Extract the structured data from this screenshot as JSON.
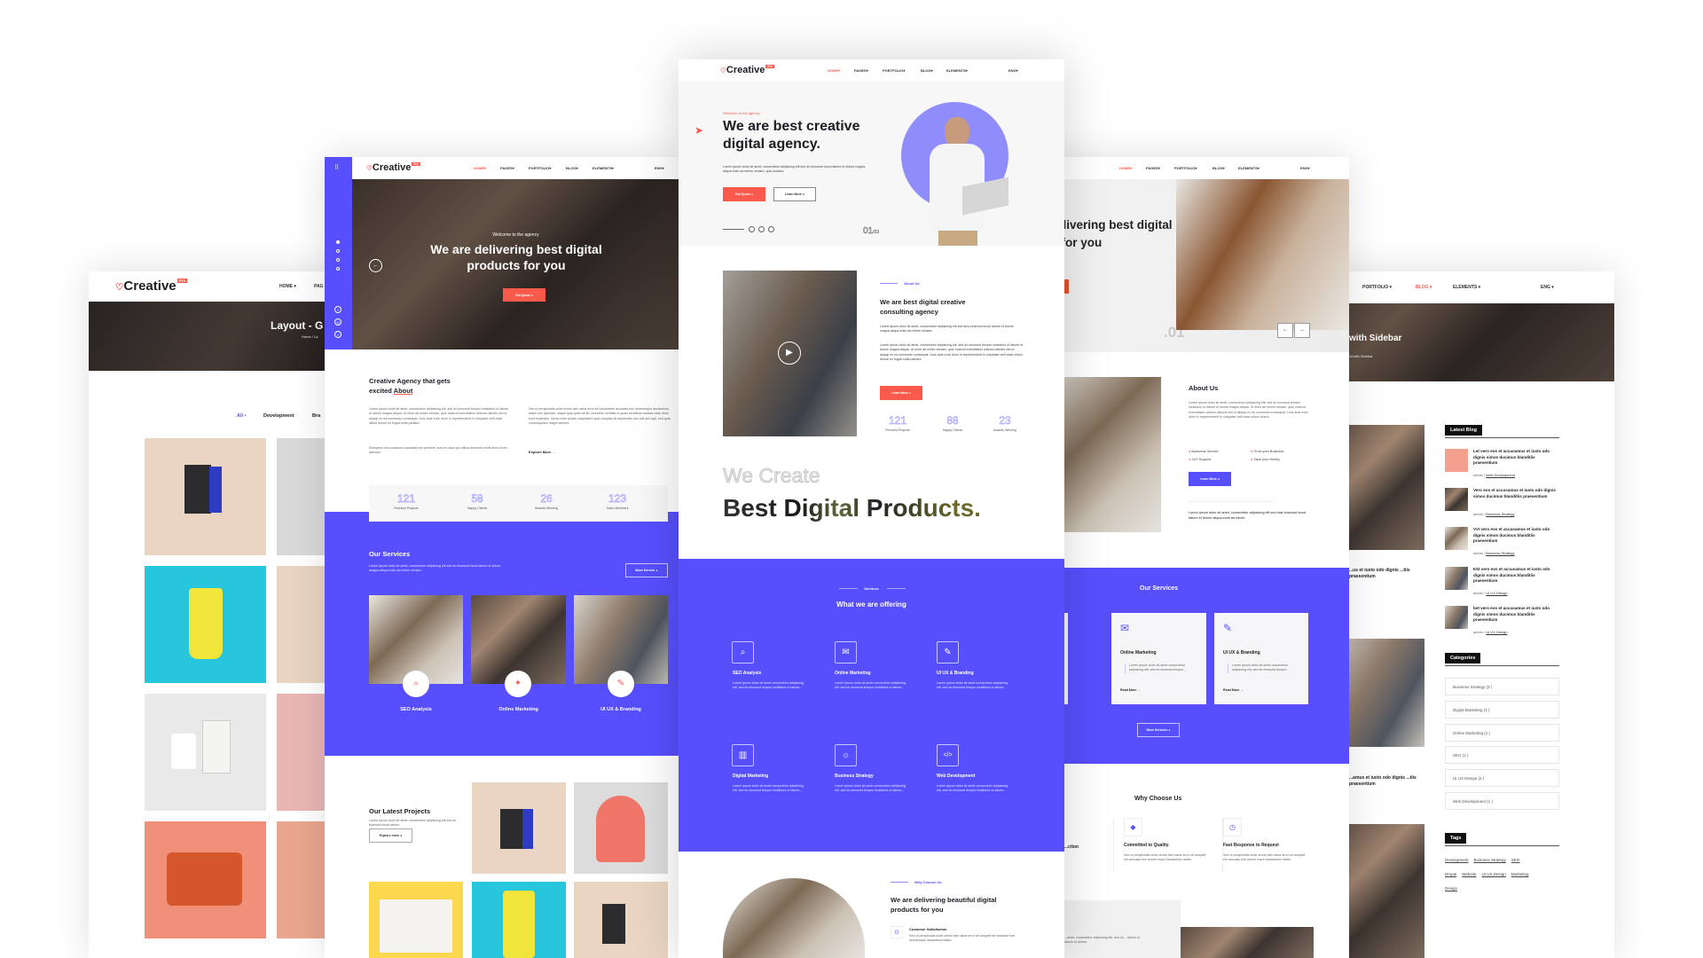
{
  "brand": {
    "logo": "Creative",
    "badge": "Pro",
    "accent": "#574ffe",
    "red": "#fa5a4c"
  },
  "nav": {
    "home": "HOME",
    "pages": "PAGES",
    "portfolio": "PORTFOLIO",
    "blog": "BLOG",
    "elements": "ELEMENTS",
    "eng": "ENG",
    "pag": "PAG"
  },
  "grid_page": {
    "hero_title": "Layout - G",
    "breadcrumb": "Home / La",
    "filters": [
      "All",
      "Development",
      "Bra"
    ]
  },
  "agency_page": {
    "hero_kicker": "Welcome to the agency",
    "hero_title": "We are delivering best digital products for you",
    "hero_btn": "Get Quote",
    "about_title_1": "Creative Agency that gets",
    "about_title_2": "excited",
    "about_title_3": "About",
    "about_p1": "Lorem ipsum dolor sit amet, consectetur adipiscing elit, sed do eiusmod tempor incididunt ut labore et dolore magna aliqua. Ut enim ad minim veniam, quis nostrud exercitation ullamco laboris nisi ut aliquip ex ea commodo consequat. Duis aute irure dolor in reprehenderit in voluptate velit esse cillum dolore eu fugiat nulla pariatur.",
    "about_p2": "Excepteur sint occaecat cupidatat non proident, sunt in culpa qui officia deserunt mollit anim id est laborum.",
    "about_p3": "Sed ut perspiciatis unde omnis iste natus error sit voluptatem accusant ium doloremque laudantium, totam rem aperiam, eaque ipsa quae ab illo inventore veritatis et quasi architecto beatae vitae dicta sunt explicabo. Nemo enim ipsam voluptatem quia voluptas sit aspernatur aut odit aut fugit, sed quia consequuntur magni dolores.",
    "explore": "Explore More →",
    "stats": [
      {
        "n": "121",
        "l": "Finished Projects"
      },
      {
        "n": "58",
        "l": "Happy Clients"
      },
      {
        "n": "26",
        "l": "Awards Winning"
      },
      {
        "n": "123",
        "l": "Team Members"
      }
    ],
    "services_title": "Our Services",
    "services_p": "Lorem ipsum dolor sit amet, consectetur adipiscing elit sed do eiusmod incod labore et dolore magna aliqua enim ad minim veniam.",
    "more_service": "More Service",
    "services": [
      "SEO Analysis",
      "Online Marketing",
      "UI UX & Branding"
    ],
    "projects_title": "Our Latest Projects",
    "projects_p": "Lorem ipsum dolor sit amet, consectetur adipiscing elit sed do eiusmod incod labore.",
    "projects_btn": "Explore more"
  },
  "home_page": {
    "kicker": "Welcome to the agency",
    "title_1": "We are best creative",
    "title_2": "digital agency.",
    "para": "Lorem ipsum dolor sit amet, consectetur adipiscing elit sed do eiusmod incod labore et dolore magna aliqua enim ad minim veniam, quis nostrud.",
    "get_quote": "Get Quote",
    "learn_more": "Learn More",
    "slide_current": "01",
    "slide_total": "/03",
    "about_label": "About Us",
    "about_title": "We are best digital creative consulting agency",
    "about_p1": "Lorem ipsum dolor sit amet, consectetur adipiscing elit sed duis eiusmod incod labore et dolore magna aliqua enim ad minim veniam.",
    "about_p2": "Lorem ipsum dolor sit amet, consectetur adipiscing elit, sed do eiusmod tempor incididunt ut labore et dolore magna aliqua. Ut enim ad minim veniam, quis nostrud exercitation ullamco laboris nisi ut aliquip ex ea commodo consequat. Duis aute irure dolor in reprehenderit in voluptate velit esse cillum dolore eu fugiat nulla pariatur.",
    "about_btn": "Learn More",
    "stats": [
      {
        "n": "121",
        "l": "Finished Projects"
      },
      {
        "n": "88",
        "l": "Happy Clients"
      },
      {
        "n": "23",
        "l": "Awards Winning"
      }
    ],
    "we_create": "We Create",
    "best_digital": "Best Digital Products.",
    "services_label": "Services",
    "services_title": "What we are offering",
    "service_desc": "Lorem ipsum dolor sit amet consectetur adipiscing elit, sed do eiusmod tempor incididunt ut labore...",
    "services": [
      {
        "t": "SEO Analysis",
        "icon": "search-chart-icon"
      },
      {
        "t": "Online Marketing",
        "icon": "megaphone-icon"
      },
      {
        "t": "UI UX & Branding",
        "icon": "pen-tool-icon"
      },
      {
        "t": "Digital Marketing",
        "icon": "bar-chart-icon"
      },
      {
        "t": "Business Strategy",
        "icon": "lightbulb-icon"
      },
      {
        "t": "Web Development",
        "icon": "code-window-icon"
      }
    ],
    "why_label": "Why Choose Us",
    "why_title": "We are delivering beautiful digital products for you",
    "why_item_title": "Customer Satisfaction",
    "why_item_text": "Sed ut perspiciatis unde omnis iste natus error sit voluptat em accusan ium doloremque laudantium totam."
  },
  "business_page": {
    "hero_title": "We are delivering best digital products for you",
    "slide": ".01",
    "about_title": "About Us",
    "about_p": "Lorem ipsum dolor sit amet, consectetur adipiscing elit, sed do eiusmod tempor incididunt ut labore et dolore magna aliqua. Ut enim ad minim veniam, quis nostrud exercitation ullamco laboris nisi ut aliquip ex ea commodo consequat. Duis aute irure dolor in reprehenderit in voluptate velit esse cillum dolore.",
    "checks": [
      "Awesome Service",
      "Grow your Business",
      "24/7 Support",
      "Save your Money"
    ],
    "about_btn": "Learn More",
    "about_p2": "Lorem ipsum dolor sit amet, consectetur adipiscing elit sed duis eiusmod incod labore et dolore aliqua enim ad minim.",
    "services_title": "Our Services",
    "cards": [
      {
        "t": "Online Marketing",
        "d": "Lorem ipsum dolor sit amet consectetur adipiscing elit, sed do eiusmod tempor..."
      },
      {
        "t": "UI UX & Branding",
        "d": "Lorem ipsum dolor sit amet consectetur adipiscing elit, sed do eiusmod tempor..."
      }
    ],
    "card_partial": "...amet ...elit, sed do",
    "read_more": "Read More →",
    "more_services": "More Services",
    "why_title": "Why Choose Us",
    "why": [
      {
        "t": "Committed to Quality",
        "d": "Sed ut perspiciatis unde omnis iste natus error sit voluptat em accusan ium dolore mque laudantium totam."
      },
      {
        "t": "Fast Response to Request",
        "d": "Sed ut perspiciatis unde omnis iste natus error sit voluptat em accusan ium dolore mque laudantium totam."
      }
    ],
    "why_partial": "...ction",
    "bottom_p": "...amet, consectetur adipiscing elit, sed do ...didunt ut labore et dolore."
  },
  "blog_page": {
    "hero_title": "with Sidebar",
    "breadcrumb": "Grid with Sidebar",
    "post_excerpt_1": "...us et iusto odo dignis ...tiis praesentium",
    "post_excerpt_2": "...amus et iusto odo dignis ...tiis praesentium",
    "latest_blog": "Latest Blog",
    "posts": [
      {
        "t": "Let vero eos et accusamus et iusto odo dignis simos ducimus blanditiis praesentium",
        "a": "admin / ",
        "c": "Web Development"
      },
      {
        "t": "Vero eos et accusamus et iusto odo dignis simos ducimus blanditiis praesentium",
        "a": "admin / ",
        "c": "Business Strategy"
      },
      {
        "t": "Vvt vero eos et accusamus et iusto odo dignis simos ducimus blanditiis praesentium",
        "a": "admin / ",
        "c": "Business Strategy"
      },
      {
        "t": "Kkt vero eos et accusamus et iusto odo dignis simos ducimus blanditiis praesentium",
        "a": "admin / ",
        "c": "UI UX Design"
      },
      {
        "t": "bet vero eos et accusamus et iusto odo dignis simos ducimus blanditiis praesentium",
        "a": "admin / ",
        "c": "UI UX Design"
      }
    ],
    "categories_title": "Categories",
    "categories": [
      "Business Strategy (3 )",
      "Digital Marketing (1 )",
      "Online Marketing (1 )",
      "SEO (1 )",
      "UI UX Design (2 )",
      "Web Development (1 )"
    ],
    "tags_title": "Tags",
    "tags": [
      "Development",
      "Business Strategy",
      "SEO",
      "Drupal",
      "Website",
      "UI UX Design",
      "Marketing",
      "Design"
    ]
  }
}
